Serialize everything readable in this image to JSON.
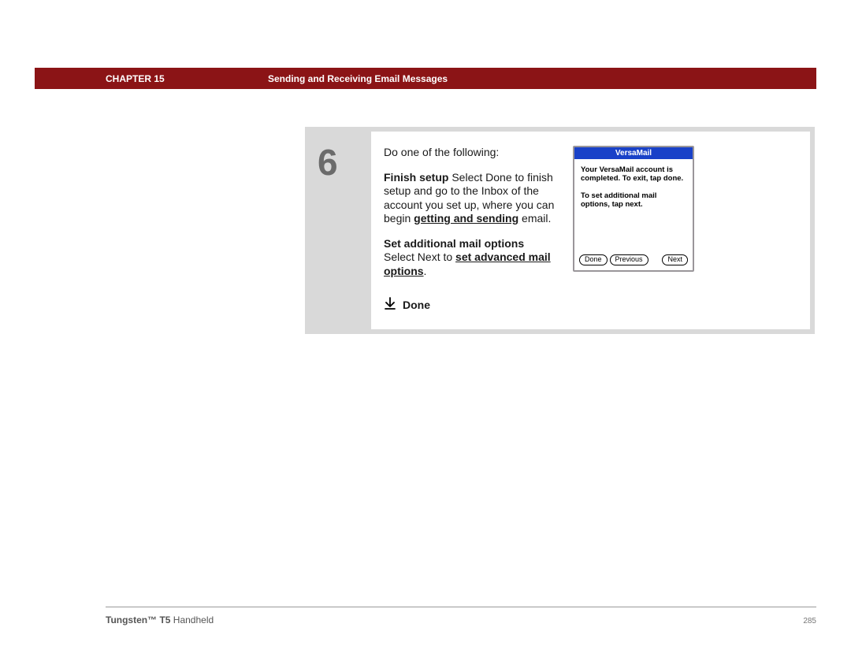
{
  "header": {
    "chapter": "CHAPTER 15",
    "title": "Sending and Receiving Email Messages"
  },
  "step": {
    "number": "6",
    "intro": "Do one of the following:",
    "finish": {
      "label": "Finish setup",
      "t1": "   Select Done to finish setup and go to the Inbox of the account you set up, where you can begin ",
      "link": "getting and sending",
      "t2": " email."
    },
    "addl": {
      "label": "Set additional mail options",
      "t1": "Select Next to ",
      "link": "set advanced mail options",
      "t2": "."
    },
    "done_label": "Done"
  },
  "device": {
    "title": "VersaMail",
    "body1": "Your VersaMail account is completed.   To exit, tap done.",
    "body2": "To set additional mail options, tap next.",
    "buttons": {
      "done": "Done",
      "previous": "Previous",
      "next": "Next"
    }
  },
  "footer": {
    "product_bold": "Tungsten™ T5",
    "product_rest": " Handheld",
    "page": "285"
  }
}
